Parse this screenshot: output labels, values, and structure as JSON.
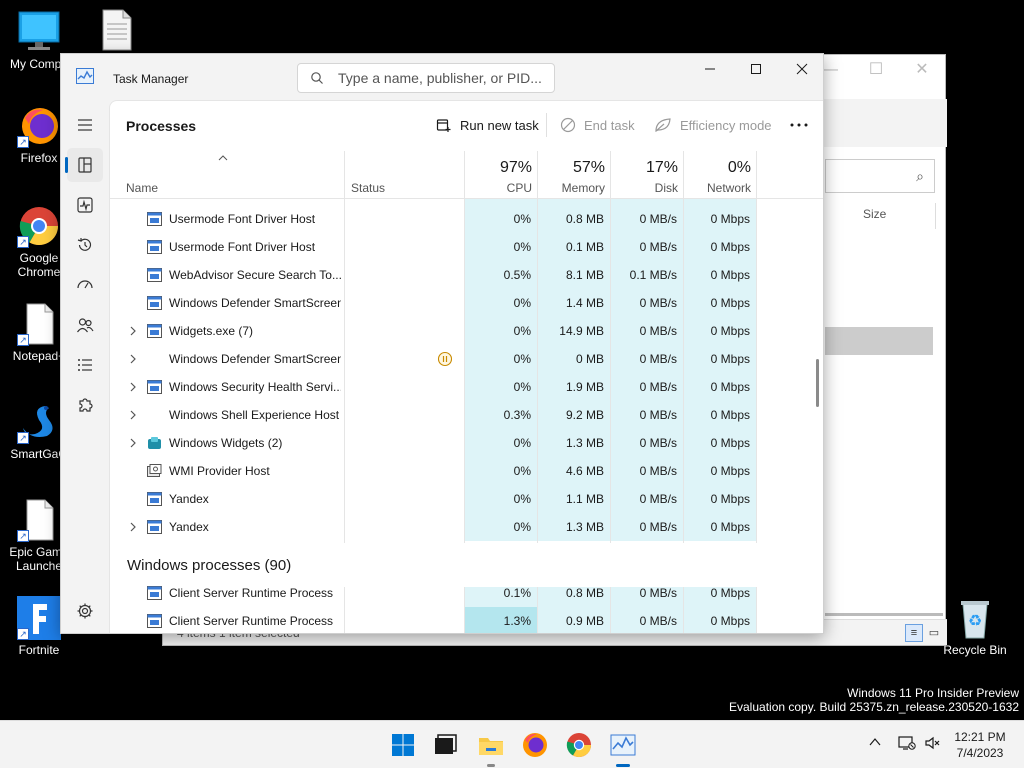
{
  "desktop": {
    "icons": [
      {
        "label": "My Compu"
      },
      {
        "label": ""
      },
      {
        "label": "Firefox"
      },
      {
        "label": "Google Chrome"
      },
      {
        "label": "Notepad+"
      },
      {
        "label": "SmartGaG"
      },
      {
        "label": "Epic Game Launche"
      },
      {
        "label": "Fortnite"
      },
      {
        "label": "Recycle Bin"
      }
    ],
    "watermark_line1": "Windows 11 Pro Insider Preview",
    "watermark_line2": "Evaluation copy. Build 25375.zn_release.230520-1632"
  },
  "explorer": {
    "size_header": "Size",
    "status_text": "4 items    1 item selected"
  },
  "taskmanager": {
    "title": "Task Manager",
    "search_placeholder": "Type a name, publisher, or PID...",
    "page_title": "Processes",
    "commands": {
      "run_new_task": "Run new task",
      "end_task": "End task",
      "efficiency_mode": "Efficiency mode"
    },
    "columns": {
      "name": "Name",
      "status": "Status",
      "cpu": {
        "label": "CPU",
        "percent": "97%"
      },
      "memory": {
        "label": "Memory",
        "percent": "57%"
      },
      "disk": {
        "label": "Disk",
        "percent": "17%"
      },
      "network": {
        "label": "Network",
        "percent": "0%"
      }
    },
    "rows": [
      {
        "name": "Usermode Font Driver Host",
        "expandable": false,
        "icon": "window-icon",
        "status": "",
        "cpu": "0%",
        "memory": "0.8 MB",
        "disk": "0 MB/s",
        "network": "0 Mbps"
      },
      {
        "name": "Usermode Font Driver Host",
        "expandable": false,
        "icon": "window-icon",
        "status": "",
        "cpu": "0%",
        "memory": "0.1 MB",
        "disk": "0 MB/s",
        "network": "0 Mbps"
      },
      {
        "name": "WebAdvisor Secure Search To...",
        "expandable": false,
        "icon": "window-icon",
        "status": "",
        "cpu": "0.5%",
        "memory": "8.1 MB",
        "disk": "0.1 MB/s",
        "network": "0 Mbps"
      },
      {
        "name": "Windows Defender SmartScreen",
        "expandable": false,
        "icon": "window-icon",
        "status": "",
        "cpu": "0%",
        "memory": "1.4 MB",
        "disk": "0 MB/s",
        "network": "0 Mbps"
      },
      {
        "name": "Widgets.exe (7)",
        "expandable": true,
        "icon": "window-icon",
        "status": "",
        "cpu": "0%",
        "memory": "14.9 MB",
        "disk": "0 MB/s",
        "network": "0 Mbps"
      },
      {
        "name": "Windows Defender SmartScreen",
        "expandable": true,
        "icon": "none",
        "status": "suspended",
        "cpu": "0%",
        "memory": "0 MB",
        "disk": "0 MB/s",
        "network": "0 Mbps"
      },
      {
        "name": "Windows Security Health Servi...",
        "expandable": true,
        "icon": "window-icon",
        "status": "",
        "cpu": "0%",
        "memory": "1.9 MB",
        "disk": "0 MB/s",
        "network": "0 Mbps"
      },
      {
        "name": "Windows Shell Experience Host",
        "expandable": true,
        "icon": "none",
        "status": "",
        "cpu": "0.3%",
        "memory": "9.2 MB",
        "disk": "0 MB/s",
        "network": "0 Mbps"
      },
      {
        "name": "Windows Widgets (2)",
        "expandable": true,
        "icon": "widgets-icon",
        "status": "",
        "cpu": "0%",
        "memory": "1.3 MB",
        "disk": "0 MB/s",
        "network": "0 Mbps"
      },
      {
        "name": "WMI Provider Host",
        "expandable": false,
        "icon": "wmi-icon",
        "status": "",
        "cpu": "0%",
        "memory": "4.6 MB",
        "disk": "0 MB/s",
        "network": "0 Mbps"
      },
      {
        "name": "Yandex",
        "expandable": false,
        "icon": "window-icon",
        "status": "",
        "cpu": "0%",
        "memory": "1.1 MB",
        "disk": "0 MB/s",
        "network": "0 Mbps"
      },
      {
        "name": "Yandex",
        "expandable": true,
        "icon": "window-icon",
        "status": "",
        "cpu": "0%",
        "memory": "1.3 MB",
        "disk": "0 MB/s",
        "network": "0 Mbps"
      }
    ],
    "group_title": "Windows processes (90)",
    "group_rows": [
      {
        "name": "Client Server Runtime Process",
        "expandable": false,
        "icon": "window-icon",
        "status": "",
        "cpu": "0.1%",
        "memory": "0.8 MB",
        "disk": "0 MB/s",
        "network": "0 Mbps"
      },
      {
        "name": "Client Server Runtime Process",
        "expandable": false,
        "icon": "window-icon",
        "status": "",
        "cpu": "1.3%",
        "memory": "0.9 MB",
        "disk": "0 MB/s",
        "network": "0 Mbps"
      }
    ]
  },
  "taskbar": {
    "time": "12:21 PM",
    "date": "7/4/2023"
  },
  "colors": {
    "accent": "#0067c0",
    "cell_tint": "#def4f8",
    "cell_tint_hot": "#b4e6ee",
    "suspend": "#c88a00"
  }
}
